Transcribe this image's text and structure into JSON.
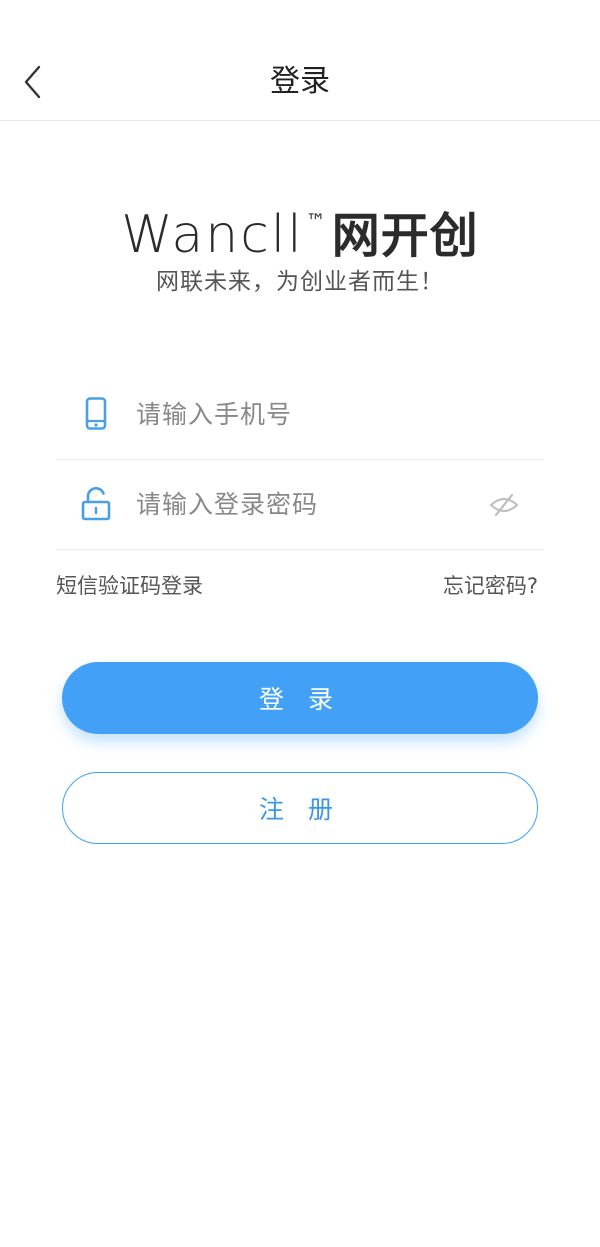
{
  "header": {
    "title": "登录",
    "back_icon": "chevron-left-icon"
  },
  "brand": {
    "name_latin": "Wancll",
    "trademark": "™",
    "name_cn": "网开创",
    "slogan": "网联未来，为创业者而生！"
  },
  "form": {
    "phone": {
      "placeholder": "请输入手机号",
      "value": "",
      "icon": "phone-icon"
    },
    "password": {
      "placeholder": "请输入登录密码",
      "value": "",
      "icon": "unlock-icon",
      "toggle_icon": "eye-off-icon"
    }
  },
  "links": {
    "sms_login": "短信验证码登录",
    "forgot_password": "忘记密码?"
  },
  "buttons": {
    "login": "登 录",
    "register": "注 册"
  },
  "colors": {
    "accent": "#42a1f7",
    "icon": "#4a9fe6",
    "text": "#333333",
    "muted": "#888888",
    "divider": "#ececec"
  }
}
